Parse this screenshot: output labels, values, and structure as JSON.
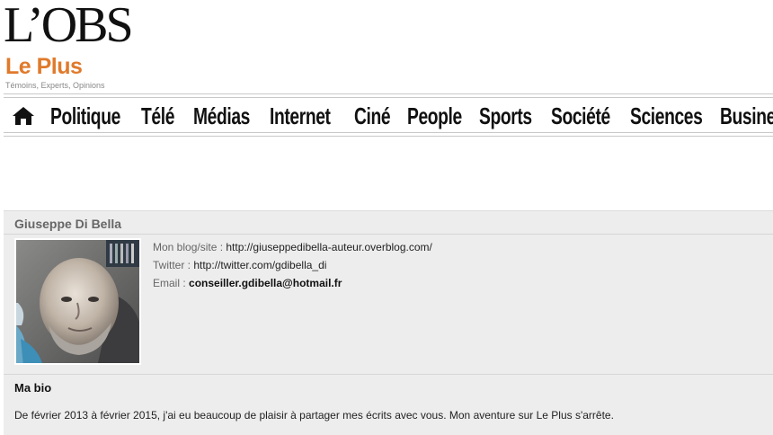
{
  "header": {
    "logo_main": "L’OBS",
    "logo_sub": "Le Plus",
    "tagline": "Témoins, Experts, Opinions"
  },
  "nav": {
    "home_icon": "home-icon",
    "items": [
      "Politique",
      "Télé",
      "Médias",
      "Internet",
      "Ciné",
      "People",
      "Sports",
      "Société",
      "Sciences",
      "Business"
    ]
  },
  "profile": {
    "name": "Giuseppe Di Bella",
    "avatar_icon": "author-photo",
    "blog_label": "Mon blog/site : ",
    "blog_value": "http://giuseppedibella-auteur.overblog.com/",
    "twitter_label": "Twitter : ",
    "twitter_value": "http://twitter.com/gdibella_di",
    "email_label": "Email : ",
    "email_value": "conseiller.gdibella@hotmail.fr"
  },
  "bio": {
    "title": "Ma bio",
    "text": "De février 2013 à février 2015, j'ai eu beaucoup de plaisir à partager mes écrits avec vous. Mon aventure sur Le Plus s'arrête."
  },
  "colors": {
    "brand_orange": "#e07a2b",
    "panel_bg": "#ededed"
  }
}
